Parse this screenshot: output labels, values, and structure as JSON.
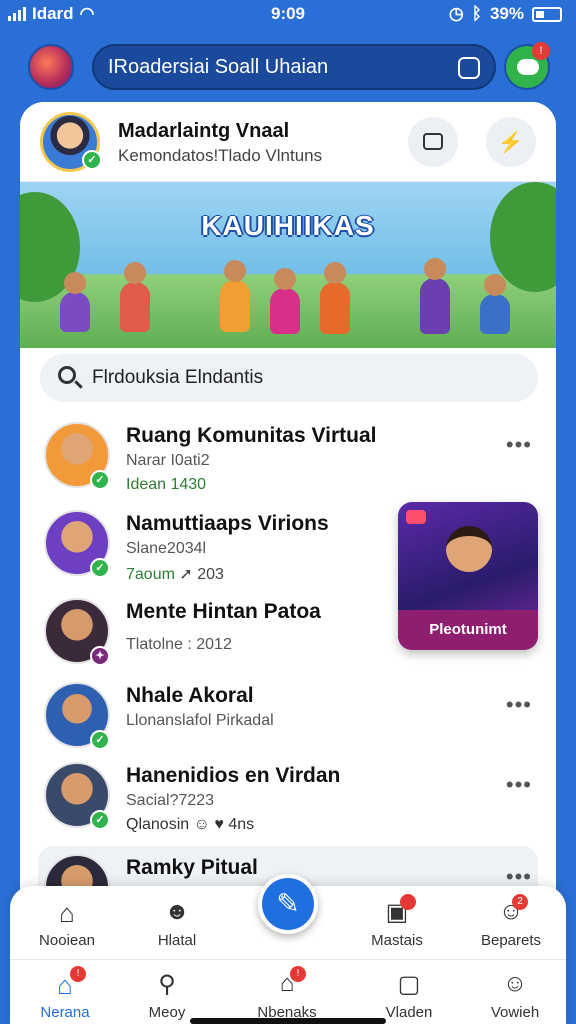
{
  "status_bar": {
    "carrier": "Idard",
    "time": "9:09",
    "battery": "39%"
  },
  "topbar": {
    "search_text": "IRoadersiai Soall Uhaian"
  },
  "profile": {
    "name": "Madarlaintg Vnaal",
    "subtitle": "Kemondatos!Tlado Vlntuns"
  },
  "banner": {
    "title": "KAUIHIIKAS"
  },
  "search": {
    "placeholder": "Flrdouksia Elndantis"
  },
  "items": [
    {
      "title": "Ruang Komunitas Virtual",
      "sub": "Narar I0ati2",
      "meta": "Idean  1430",
      "menu": "•••"
    },
    {
      "title": "Namuttiaaps Virions",
      "sub": "Slane2034l",
      "meta": "7aoum",
      "meta_extra": "203",
      "menu": ""
    },
    {
      "title": "Mente Hintan Patoa",
      "sub": "Tlatolne : 2012",
      "meta": "",
      "menu": ""
    },
    {
      "title": "Nhale Akoral",
      "sub": "Llonanslafol Pirkadal",
      "meta": "",
      "menu": "•••"
    },
    {
      "title": "Hanenidios en Virdan",
      "sub": "Sacial?7223",
      "meta": "Qlanosin",
      "meta_extra": "4ns",
      "menu": "•••"
    },
    {
      "title": "Ramky Pitual",
      "sub": "",
      "meta": "",
      "menu": "•••"
    }
  ],
  "promo": {
    "label": "Pleotunimt"
  },
  "nav_top": [
    {
      "label": "Nooiean",
      "icon": "home-icon"
    },
    {
      "label": "Hlatal",
      "icon": "chat-icon"
    },
    {
      "label": "Mastais",
      "icon": "media-icon"
    },
    {
      "label": "Beparets",
      "icon": "profile-icon"
    }
  ],
  "nav_bottom": [
    {
      "label": "Nerana",
      "icon": "home-icon"
    },
    {
      "label": "Meoy",
      "icon": "search-icon"
    },
    {
      "label": "Nbenaks",
      "icon": "store-icon"
    },
    {
      "label": "Vladen",
      "icon": "video-icon"
    },
    {
      "label": "Vowieh",
      "icon": "user-icon"
    }
  ],
  "colors": {
    "background": "#2a6fd6",
    "accent": "#1f6fe0",
    "verified": "#2fb34a",
    "badge": "#e53935"
  }
}
